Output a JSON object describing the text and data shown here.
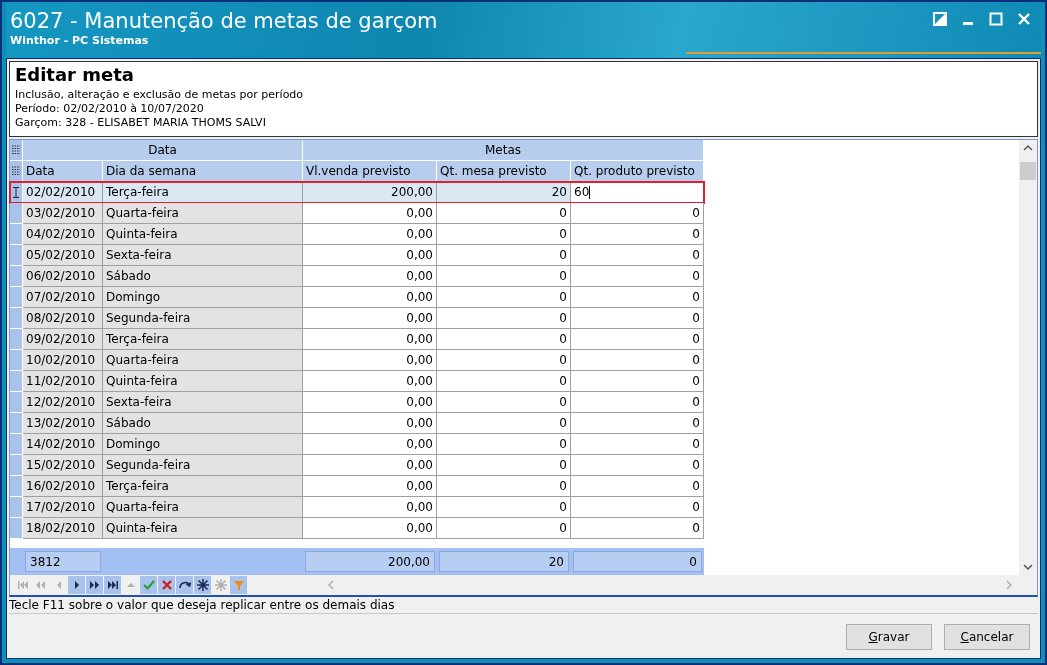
{
  "window": {
    "title": "6027 - Manutenção de metas de garçom",
    "subtitle": "Winthor - PC Sistemas"
  },
  "header": {
    "title": "Editar meta",
    "lines": [
      "Inclusão, alteração e exclusão de metas por período",
      "Período: 02/02/2010 à 10/07/2020",
      "Garçom: 328 - ELISABET MARIA THOMS SALVI"
    ]
  },
  "grid": {
    "bands": [
      {
        "label": "Data"
      },
      {
        "label": "Metas"
      }
    ],
    "columns": [
      {
        "label": "Data",
        "readonly": true
      },
      {
        "label": "Dia da semana",
        "readonly": true
      },
      {
        "label": "Vl.venda previsto",
        "readonly": false
      },
      {
        "label": "Qt. mesa previsto",
        "readonly": false
      },
      {
        "label": "Qt. produto previsto",
        "readonly": false
      }
    ],
    "rows": [
      {
        "selected": true,
        "editing": true,
        "cells": [
          "02/02/2010",
          "Terça-feira",
          "200,00",
          "20",
          "60"
        ]
      },
      {
        "selected": false,
        "cells": [
          "03/02/2010",
          "Quarta-feira",
          "0,00",
          "0",
          "0"
        ]
      },
      {
        "selected": false,
        "cells": [
          "04/02/2010",
          "Quinta-feira",
          "0,00",
          "0",
          "0"
        ]
      },
      {
        "selected": false,
        "cells": [
          "05/02/2010",
          "Sexta-feira",
          "0,00",
          "0",
          "0"
        ]
      },
      {
        "selected": false,
        "cells": [
          "06/02/2010",
          "Sábado",
          "0,00",
          "0",
          "0"
        ]
      },
      {
        "selected": false,
        "cells": [
          "07/02/2010",
          "Domingo",
          "0,00",
          "0",
          "0"
        ]
      },
      {
        "selected": false,
        "cells": [
          "08/02/2010",
          "Segunda-feira",
          "0,00",
          "0",
          "0"
        ]
      },
      {
        "selected": false,
        "cells": [
          "09/02/2010",
          "Terça-feira",
          "0,00",
          "0",
          "0"
        ]
      },
      {
        "selected": false,
        "cells": [
          "10/02/2010",
          "Quarta-feira",
          "0,00",
          "0",
          "0"
        ]
      },
      {
        "selected": false,
        "cells": [
          "11/02/2010",
          "Quinta-feira",
          "0,00",
          "0",
          "0"
        ]
      },
      {
        "selected": false,
        "cells": [
          "12/02/2010",
          "Sexta-feira",
          "0,00",
          "0",
          "0"
        ]
      },
      {
        "selected": false,
        "cells": [
          "13/02/2010",
          "Sábado",
          "0,00",
          "0",
          "0"
        ]
      },
      {
        "selected": false,
        "cells": [
          "14/02/2010",
          "Domingo",
          "0,00",
          "0",
          "0"
        ]
      },
      {
        "selected": false,
        "cells": [
          "15/02/2010",
          "Segunda-feira",
          "0,00",
          "0",
          "0"
        ]
      },
      {
        "selected": false,
        "cells": [
          "16/02/2010",
          "Terça-feira",
          "0,00",
          "0",
          "0"
        ]
      },
      {
        "selected": false,
        "cells": [
          "17/02/2010",
          "Quarta-feira",
          "0,00",
          "0",
          "0"
        ]
      },
      {
        "selected": false,
        "cells": [
          "18/02/2010",
          "Quinta-feira",
          "0,00",
          "0",
          "0"
        ]
      }
    ],
    "footer": {
      "count": "3812",
      "totals": [
        "200,00",
        "20",
        "0"
      ]
    },
    "navigator": [
      {
        "kind": "first",
        "disabled": true
      },
      {
        "kind": "prior_page",
        "disabled": true
      },
      {
        "kind": "prior",
        "disabled": true
      },
      {
        "kind": "next",
        "disabled": false
      },
      {
        "kind": "next_page",
        "disabled": false
      },
      {
        "kind": "last",
        "disabled": false
      },
      {
        "kind": "insert",
        "disabled": true
      },
      {
        "kind": "post",
        "disabled": false
      },
      {
        "kind": "cancel",
        "disabled": false
      },
      {
        "kind": "refresh",
        "disabled": false
      },
      {
        "kind": "mark",
        "disabled": false
      },
      {
        "kind": "unmark",
        "disabled": true
      },
      {
        "kind": "filter",
        "disabled": false
      }
    ]
  },
  "hint": "Tecle F11 sobre o valor que deseja replicar entre os demais dias",
  "buttons": [
    "Gravar",
    "Cancelar"
  ]
}
